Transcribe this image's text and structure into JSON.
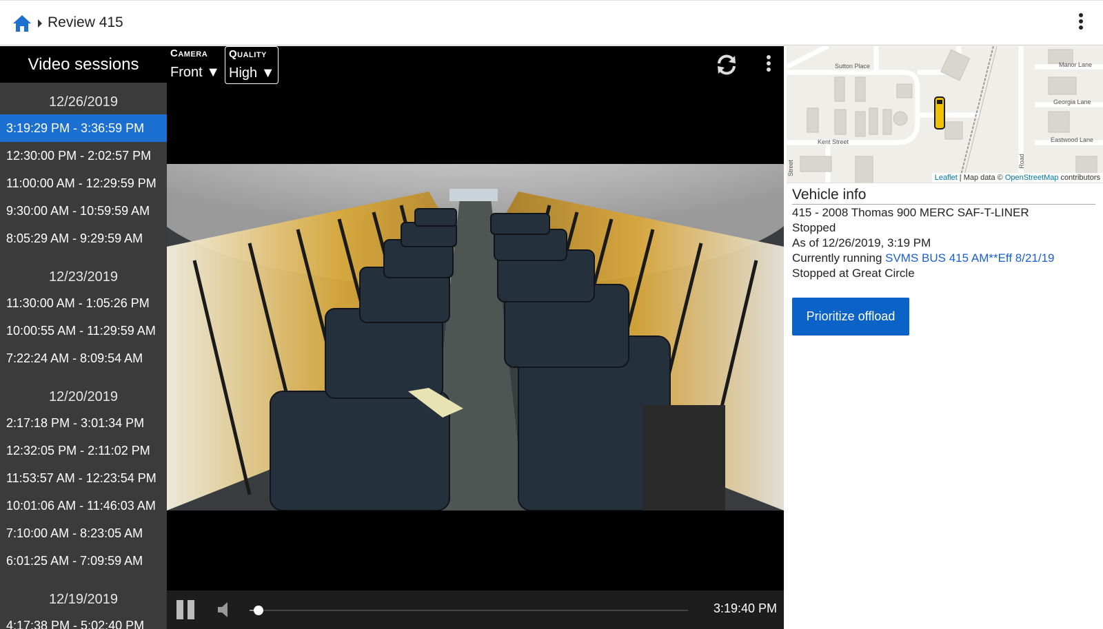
{
  "header": {
    "breadcrumb_title": "Review 415"
  },
  "sidebar": {
    "title": "Video sessions",
    "groups": [
      {
        "date": "12/26/2019",
        "sessions": [
          "3:19:29 PM - 3:36:59 PM",
          "12:30:00 PM - 2:02:57 PM",
          "11:00:00 AM - 12:29:59 PM",
          "9:30:00 AM - 10:59:59 AM",
          "8:05:29 AM - 9:29:59 AM"
        ]
      },
      {
        "date": "12/23/2019",
        "sessions": [
          "11:30:00 AM - 1:05:26 PM",
          "10:00:55 AM - 11:29:59 AM",
          "7:22:24 AM - 8:09:54 AM"
        ]
      },
      {
        "date": "12/20/2019",
        "sessions": [
          "2:17:18 PM - 3:01:34 PM",
          "12:32:05 PM - 2:11:02 PM",
          "11:53:57 AM - 12:23:54 PM",
          "10:01:06 AM - 11:46:03 AM",
          "7:10:00 AM - 8:23:05 AM",
          "6:01:25 AM - 7:09:59 AM"
        ]
      },
      {
        "date": "12/19/2019",
        "sessions": [
          "4:17:38 PM - 5:02:40 PM"
        ]
      }
    ],
    "active_session": "3:19:29 PM - 3:36:59 PM",
    "active_color": "#1a6fd1"
  },
  "player": {
    "camera_caption": "Camera",
    "camera_value": "Front ▼",
    "quality_caption": "Quality",
    "quality_value": "High ▼",
    "current_time": "3:19:40 PM",
    "seek_progress": 0.02,
    "icons": [
      "refresh-icon",
      "more-vert-icon",
      "pause-icon",
      "volume-icon"
    ]
  },
  "map": {
    "streets": [
      "Sutton Place",
      "Kent Street",
      "Manor Lane",
      "Georgia Lane",
      "Eastwood Lane",
      "Street",
      "Road"
    ],
    "attribution": {
      "leaflet": "Leaflet",
      "sep": " | Map data © ",
      "osm": "OpenStreetMap",
      "suffix": " contributors"
    },
    "vehicle_marker_color": "#f2c200"
  },
  "vehicle_info": {
    "title": "Vehicle info",
    "description": "415 - 2008 Thomas 900 MERC SAF-T-LINER",
    "status": "Stopped",
    "as_of": "As of 12/26/2019, 3:19 PM",
    "running_prefix": "Currently running ",
    "running_link": "SVMS BUS 415 AM**Eff 8/21/19",
    "stopped_at": "Stopped at Great Circle",
    "prioritize_label": "Prioritize offload"
  }
}
